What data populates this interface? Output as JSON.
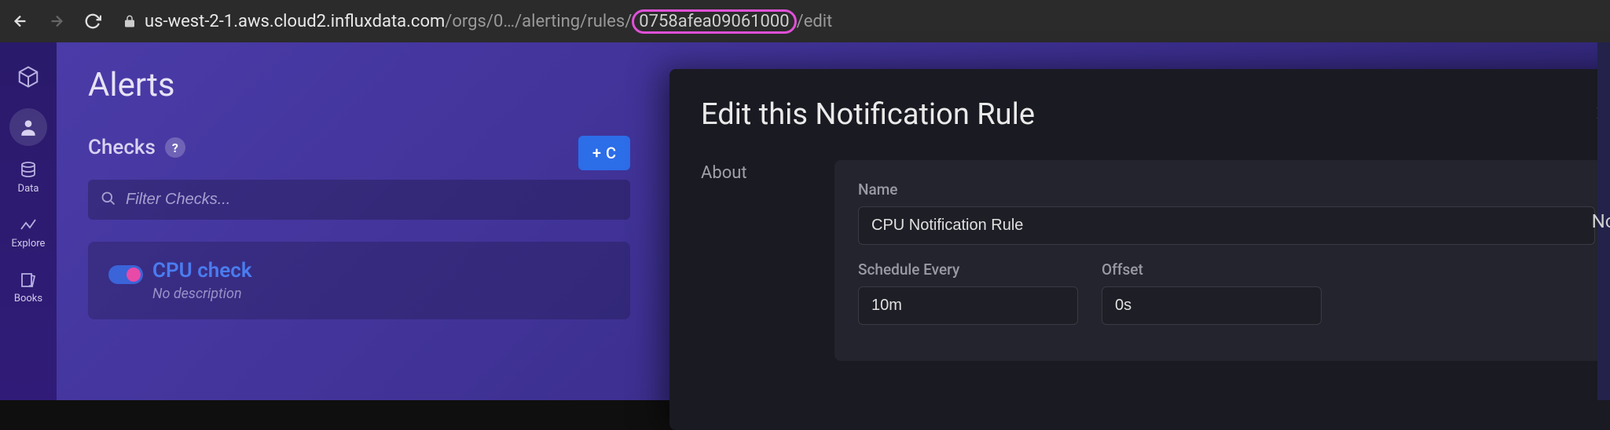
{
  "browser": {
    "url_host": "us-west-2-1.aws.cloud2.influxdata.com",
    "url_path_prefix": "/orgs/",
    "url_org_obscured": "0…",
    "url_path_mid": "/alerting/rules/",
    "url_rule_id": "0758afea09061000",
    "url_path_suffix": "/edit"
  },
  "sidebar": {
    "items": [
      {
        "icon": "cube",
        "label": ""
      },
      {
        "icon": "user",
        "label": ""
      },
      {
        "icon": "database",
        "label": "Data"
      },
      {
        "icon": "explore",
        "label": "Explore"
      },
      {
        "icon": "books",
        "label": "Books"
      }
    ]
  },
  "page": {
    "title": "Alerts",
    "checks_section": "Checks",
    "create_button": "C",
    "filter_placeholder": "Filter Checks...",
    "check_card": {
      "name": "CPU check",
      "desc": "No description"
    }
  },
  "modal": {
    "title": "Edit this Notification Rule",
    "about": "About",
    "name_label": "Name",
    "name_value": "CPU Notification Rule",
    "schedule_label": "Schedule Every",
    "schedule_value": "10m",
    "offset_label": "Offset",
    "offset_value": "0s"
  },
  "right_edge": "No"
}
